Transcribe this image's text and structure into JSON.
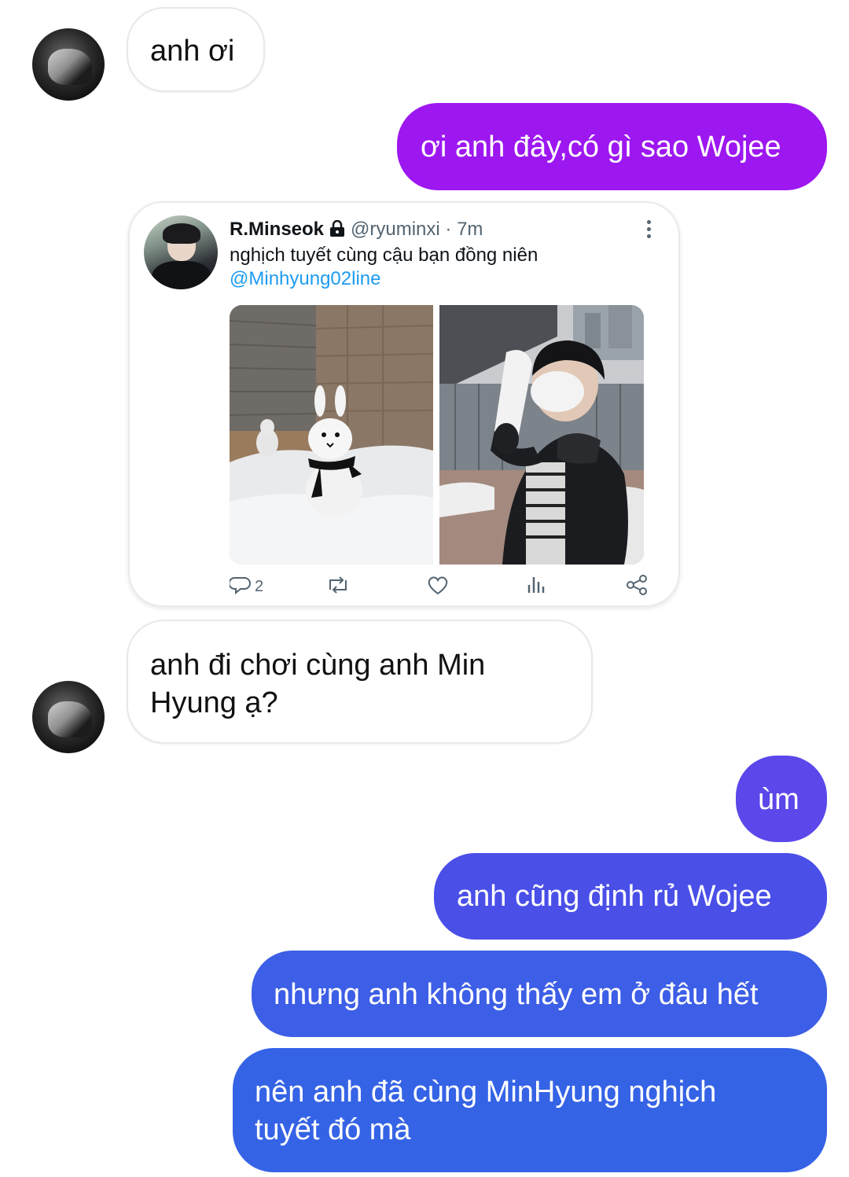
{
  "messages": {
    "m1": "anh ơi",
    "m2": "ơi anh đây,có gì sao Wojee",
    "m3": "anh đi chơi cùng anh Min Hyung ạ?",
    "m4": "ùm",
    "m5": "anh cũng định rủ Wojee",
    "m6": "nhưng anh không thấy em ở đâu hết",
    "m7": "nên anh đã cùng MinHyung nghịch tuyết đó mà"
  },
  "tweet": {
    "name": "R.Minseok",
    "handle": "@ryuminxi",
    "time": "· 7m",
    "text": "nghịch tuyết cùng cậu bạn đồng niên",
    "mention": "@Minhyung02line",
    "replies": "2",
    "icons": [
      "reply-icon",
      "retweet-icon",
      "like-icon",
      "views-icon",
      "share-icon",
      "lock-icon",
      "more-icon"
    ]
  },
  "colors": {
    "purple": "#9d17f0",
    "violet": "#5b47ea",
    "blue1": "#4a4fe8",
    "blue2": "#3d5ee6",
    "blue3": "#3563e6",
    "twitter_blue": "#1d9bf0"
  }
}
